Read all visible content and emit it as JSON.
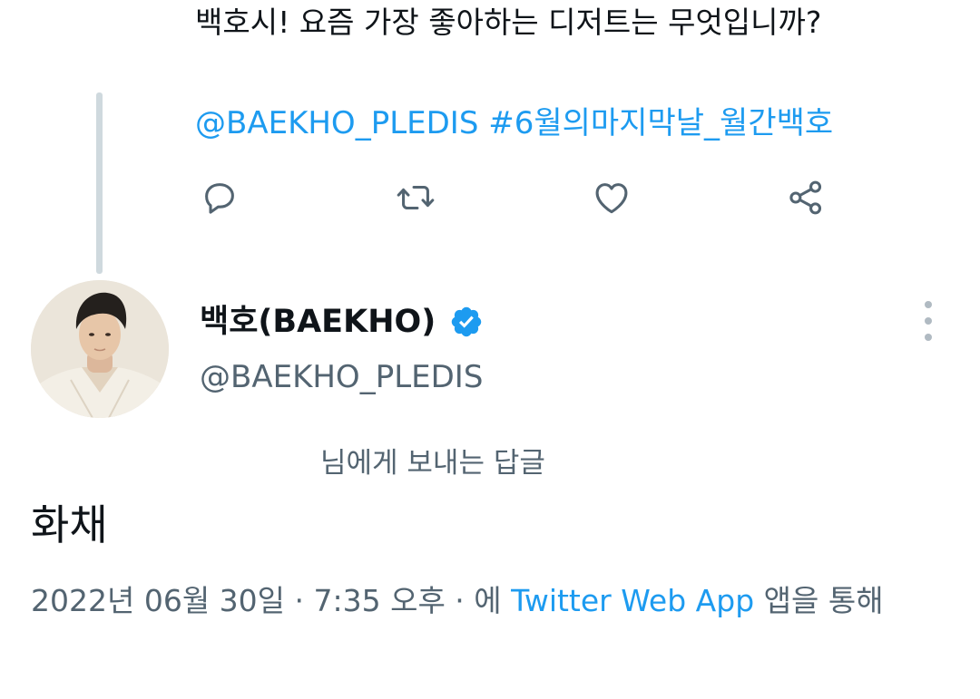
{
  "previous_tweet": {
    "text": "백호시! 요즘 가장 좋아하는 디저트는 무엇입니까?",
    "mention": "@BAEKHO_PLEDIS",
    "hashtag": "#6월의마지막날_월간백호"
  },
  "actions": {
    "reply": "reply-icon",
    "retweet": "retweet-icon",
    "like": "heart-icon",
    "share": "share-icon"
  },
  "reply_tweet": {
    "display_name": "백호(BAEKHO)",
    "handle": "@BAEKHO_PLEDIS",
    "verified": true,
    "reply_to_label": "님에게 보내는 답글",
    "body": "화채",
    "date_prefix": "2022년 06월 30일 · 7:35 오후 · 에 ",
    "source_app": "Twitter Web App",
    "date_suffix": " 앱을 통해"
  },
  "colors": {
    "link": "#1d9bf0",
    "secondary_text": "#536471",
    "primary_text": "#0f1419",
    "thread_line": "#cfd9de"
  }
}
